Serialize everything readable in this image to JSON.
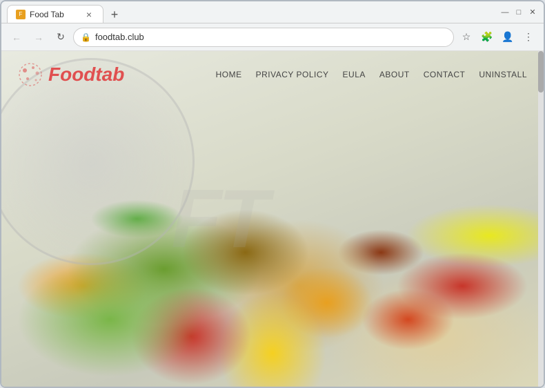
{
  "browser": {
    "tab": {
      "favicon": "F",
      "title": "Food Tab",
      "close_label": "×"
    },
    "new_tab_label": "+",
    "window_controls": {
      "minimize": "—",
      "maximize": "□",
      "close": "✕"
    },
    "nav": {
      "back_label": "←",
      "forward_label": "→",
      "reload_label": "↻",
      "url": "foodtab.club",
      "bookmark_label": "☆",
      "extensions_label": "🧩",
      "account_label": "👤",
      "menu_label": "⋮"
    }
  },
  "website": {
    "logo": "Foodtab",
    "watermark": "FT",
    "nav_links": [
      {
        "label": "HOME",
        "id": "home"
      },
      {
        "label": "PRIVACY POLICY",
        "id": "privacy-policy"
      },
      {
        "label": "EULA",
        "id": "eula"
      },
      {
        "label": "ABOUT",
        "id": "about"
      },
      {
        "label": "CONTACT",
        "id": "contact"
      },
      {
        "label": "UNINSTALL",
        "id": "uninstall"
      }
    ]
  }
}
